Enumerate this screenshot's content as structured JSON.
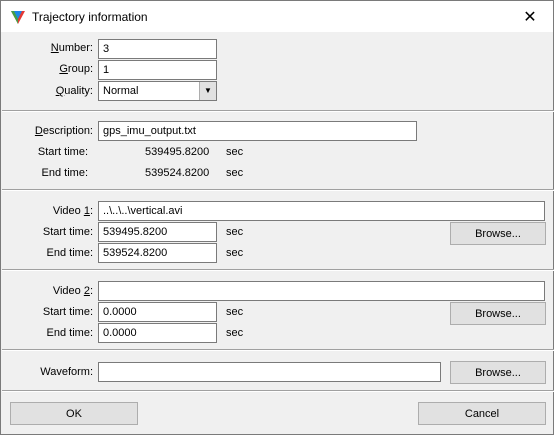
{
  "window": {
    "title": "Trajectory information",
    "close_glyph": "✕"
  },
  "general": {
    "number_label": "Number:",
    "number_value": "3",
    "group_label": "Group:",
    "group_value": "1",
    "quality_label": "Quality:",
    "quality_value": "Normal"
  },
  "description": {
    "label": "Description:",
    "value": "gps_imu_output.txt",
    "start_label": "Start time:",
    "start_value": "539495.8200",
    "start_unit": "sec",
    "end_label": "End time:",
    "end_value": "539524.8200",
    "end_unit": "sec"
  },
  "video1": {
    "label": "Video 1:",
    "value": "..\\..\\..\\vertical.avi",
    "start_label": "Start time:",
    "start_value": "539495.8200",
    "start_unit": "sec",
    "end_label": "End time:",
    "end_value": "539524.8200",
    "end_unit": "sec",
    "browse_label": "Browse..."
  },
  "video2": {
    "label": "Video 2:",
    "value": "",
    "start_label": "Start time:",
    "start_value": "0.0000",
    "start_unit": "sec",
    "end_label": "End time:",
    "end_value": "0.0000",
    "end_unit": "sec",
    "browse_label": "Browse..."
  },
  "waveform": {
    "label": "Waveform:",
    "value": "",
    "browse_label": "Browse..."
  },
  "footer": {
    "ok_label": "OK",
    "cancel_label": "Cancel"
  },
  "icons": {
    "app": "trajectory-app-icon",
    "close": "close-icon",
    "dropdown": "chevron-down-icon"
  }
}
